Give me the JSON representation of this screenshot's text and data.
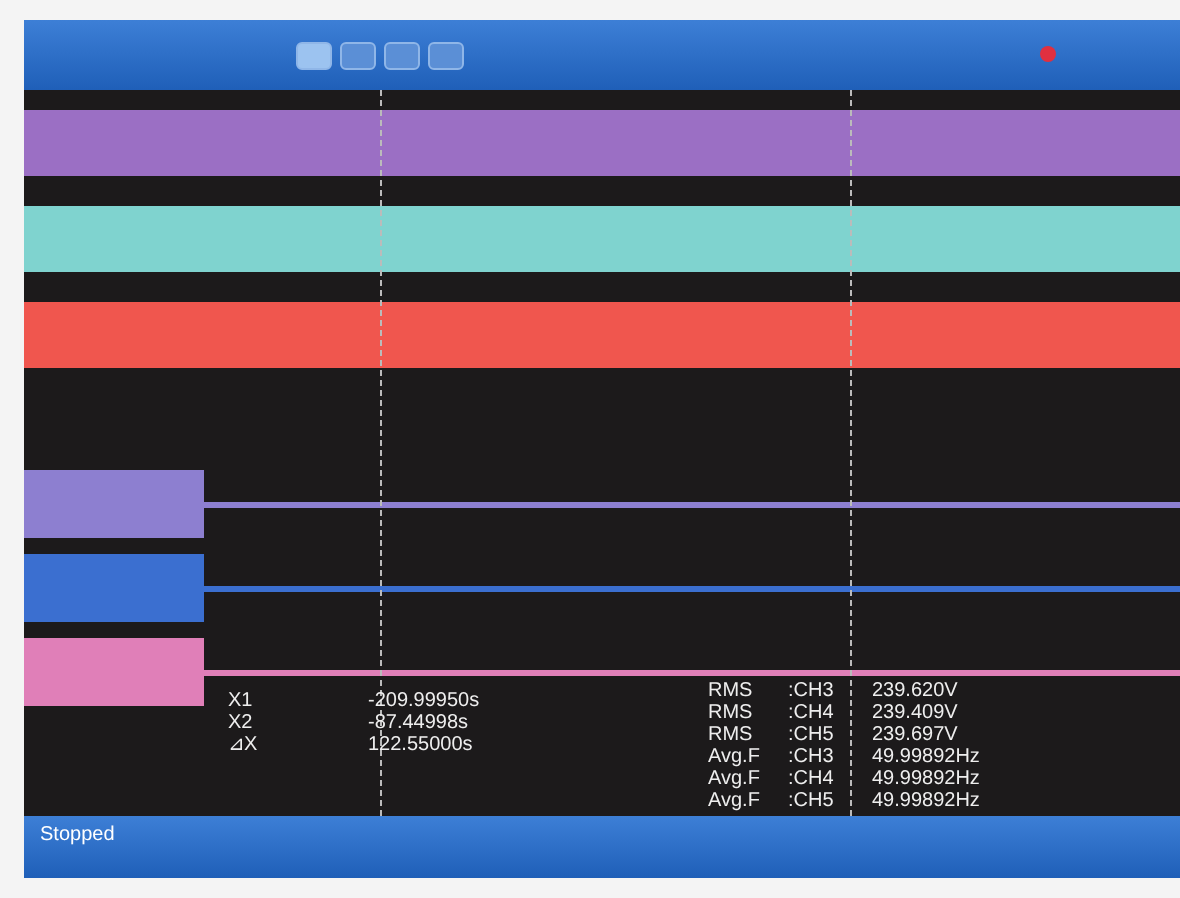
{
  "toolbar": {
    "buttons": [
      {
        "selected": true
      },
      {
        "selected": false
      },
      {
        "selected": false
      },
      {
        "selected": false
      }
    ]
  },
  "channels": [
    {
      "kind": "band",
      "color": "#9b6fc4"
    },
    {
      "kind": "band",
      "color": "#7fd3cf"
    },
    {
      "kind": "band",
      "color": "#f0564e"
    },
    {
      "kind": "trace",
      "color": "#8d7fd0"
    },
    {
      "kind": "trace",
      "color": "#3b6fd0"
    },
    {
      "kind": "trace",
      "color": "#e07fb8"
    }
  ],
  "cursors": [
    {
      "label": "X1",
      "value": "-209.99950s"
    },
    {
      "label": "X2",
      "value": "-87.44998s"
    },
    {
      "label": "⊿X",
      "value": "122.55000s"
    }
  ],
  "measurements": [
    {
      "item": "RMS",
      "channel": ":CH3",
      "value": "239.620V"
    },
    {
      "item": "RMS",
      "channel": ":CH4",
      "value": "239.409V"
    },
    {
      "item": "RMS",
      "channel": ":CH5",
      "value": "239.697V"
    },
    {
      "item": "Avg.F",
      "channel": ":CH3",
      "value": "49.99892Hz"
    },
    {
      "item": "Avg.F",
      "channel": ":CH4",
      "value": "49.99892Hz"
    },
    {
      "item": "Avg.F",
      "channel": ":CH5",
      "value": "49.99892Hz"
    }
  ],
  "status_bar": {
    "state": "Stopped"
  }
}
